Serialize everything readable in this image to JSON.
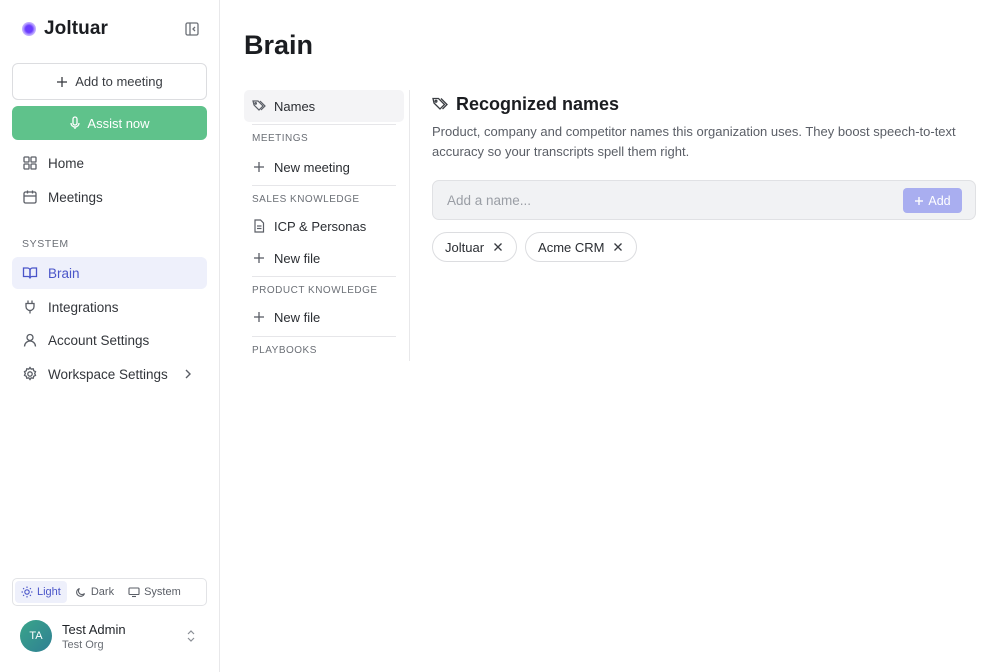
{
  "app": {
    "name": "Joltuar"
  },
  "sidebar": {
    "add_to_meeting": "Add to meeting",
    "assist_now": "Assist now",
    "nav": [
      {
        "label": "Home",
        "icon": "home-grid-icon"
      },
      {
        "label": "Meetings",
        "icon": "calendar-icon"
      }
    ],
    "system_label": "SYSTEM",
    "system_nav": [
      {
        "label": "Brain",
        "icon": "book-open-icon",
        "active": true
      },
      {
        "label": "Integrations",
        "icon": "plug-icon"
      },
      {
        "label": "Account Settings",
        "icon": "user-icon"
      },
      {
        "label": "Workspace Settings",
        "icon": "gear-icon"
      }
    ],
    "theme": {
      "light": "Light",
      "dark": "Dark",
      "system": "System",
      "selected": "Light"
    },
    "user": {
      "initials": "TA",
      "name": "Test Admin",
      "org": "Test Org"
    }
  },
  "page": {
    "title": "Brain"
  },
  "subnav": {
    "names": "Names",
    "meetings_head": "MEETINGS",
    "new_meeting": "New meeting",
    "sales_head": "SALES KNOWLEDGE",
    "icp_personas": "ICP & Personas",
    "new_file_sales": "New file",
    "product_head": "PRODUCT KNOWLEDGE",
    "new_file_product": "New file",
    "playbooks_head": "PLAYBOOKS"
  },
  "content": {
    "title": "Recognized names",
    "description": "Product, company and competitor names this organization uses. They boost speech-to-text accuracy so your transcripts spell them right.",
    "input_placeholder": "Add a name...",
    "add_label": "Add",
    "names": [
      "Joltuar",
      "Acme CRM"
    ]
  },
  "colors": {
    "accent": "#4a55c9",
    "green": "#5fc28b",
    "add_button": "#a9aef0"
  }
}
